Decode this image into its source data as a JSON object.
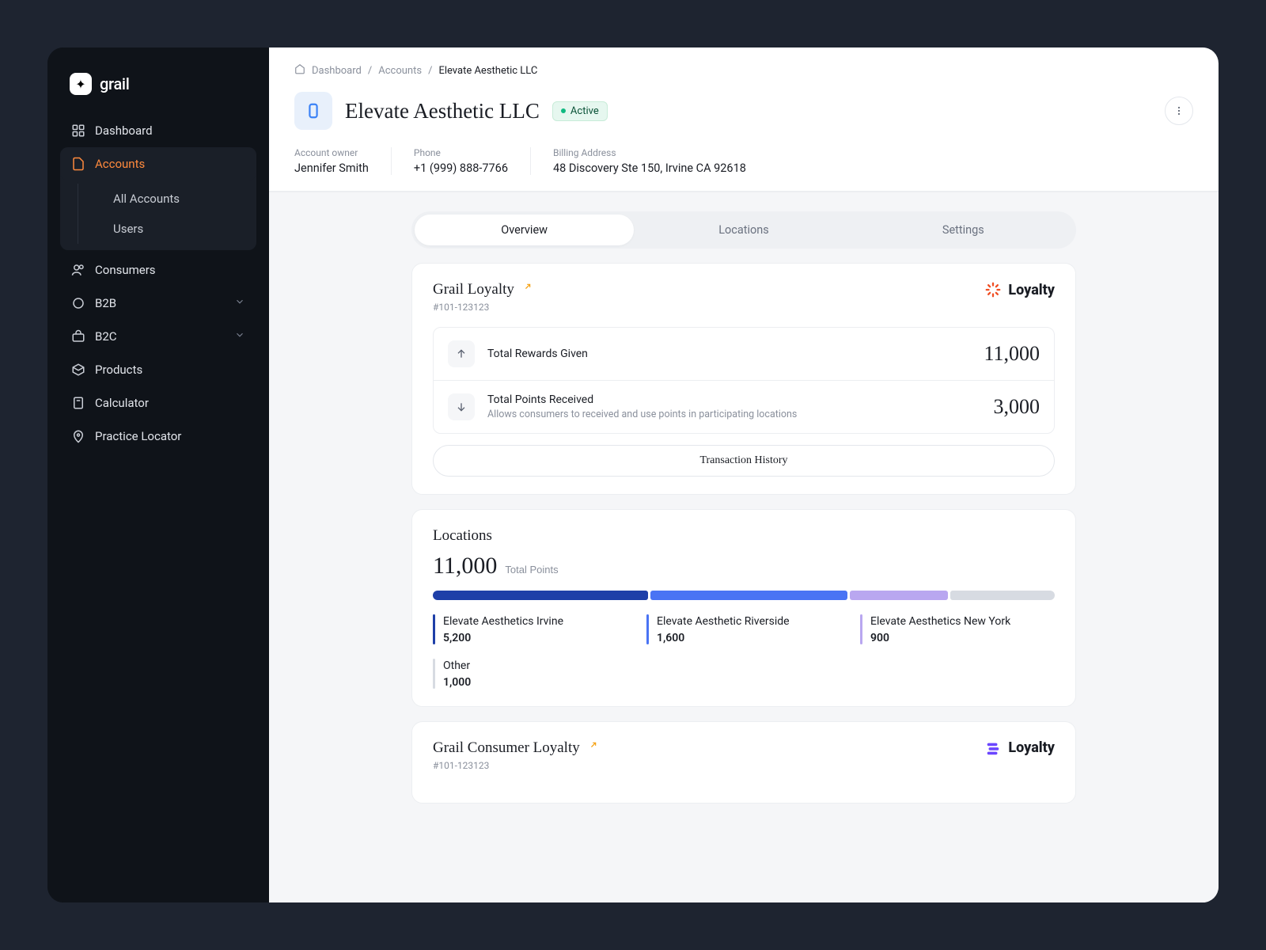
{
  "brand": "grail",
  "sidebar": {
    "items": [
      {
        "label": "Dashboard"
      },
      {
        "label": "Accounts"
      },
      {
        "label": "Consumers"
      },
      {
        "label": "B2B"
      },
      {
        "label": "B2C"
      },
      {
        "label": "Products"
      },
      {
        "label": "Calculator"
      },
      {
        "label": "Practice Locator"
      }
    ],
    "accounts_sub": [
      {
        "label": "All Accounts"
      },
      {
        "label": "Users"
      }
    ]
  },
  "breadcrumb": {
    "items": [
      "Dashboard",
      "Accounts"
    ],
    "current": "Elevate Aesthetic LLC"
  },
  "page": {
    "title": "Elevate Aesthetic LLC",
    "status": "Active"
  },
  "meta": {
    "owner_label": "Account owner",
    "owner": "Jennifer Smith",
    "phone_label": "Phone",
    "phone": "+1 (999) 888-7766",
    "address_label": "Billing Address",
    "address": "48 Discovery Ste 150, Irvine CA 92618"
  },
  "tabs": [
    "Overview",
    "Locations",
    "Settings"
  ],
  "loyalty1": {
    "title": "Grail Loyalty",
    "id": "#101-123123",
    "badge": "Loyalty",
    "badge_color": "#f04e23",
    "rewards_label": "Total Rewards Given",
    "rewards_value": "11,000",
    "points_label": "Total Points Received",
    "points_sub": "Allows consumers to received and use points in participating locations",
    "points_value": "3,000",
    "txn_btn": "Transaction History"
  },
  "locations_card": {
    "title": "Locations",
    "total": "11,000",
    "total_label": "Total Points",
    "segments": [
      {
        "name": "Elevate Aesthetics Irvine",
        "value": "5,200",
        "color": "#1e3fa8"
      },
      {
        "name": "Elevate Aesthetic Riverside",
        "value": "1,600",
        "color": "#4a74f4"
      },
      {
        "name": "Elevate Aesthetics New York",
        "value": "900",
        "color": "#b9a7f0"
      },
      {
        "name": "Other",
        "value": "1,000",
        "color": "#d7dbe2"
      }
    ],
    "bar_pct": [
      35,
      32,
      16,
      17
    ]
  },
  "loyalty2": {
    "title": "Grail Consumer Loyalty",
    "id": "#101-123123",
    "badge": "Loyalty",
    "badge_color": "#6b46ff"
  },
  "chart_data": {
    "type": "bar",
    "title": "Locations — Total Points",
    "total": 11000,
    "categories": [
      "Elevate Aesthetics Irvine",
      "Elevate Aesthetic Riverside",
      "Elevate Aesthetics New York",
      "Other"
    ],
    "values": [
      5200,
      1600,
      900,
      1000
    ],
    "colors": [
      "#1e3fa8",
      "#4a74f4",
      "#b9a7f0",
      "#d7dbe2"
    ]
  }
}
